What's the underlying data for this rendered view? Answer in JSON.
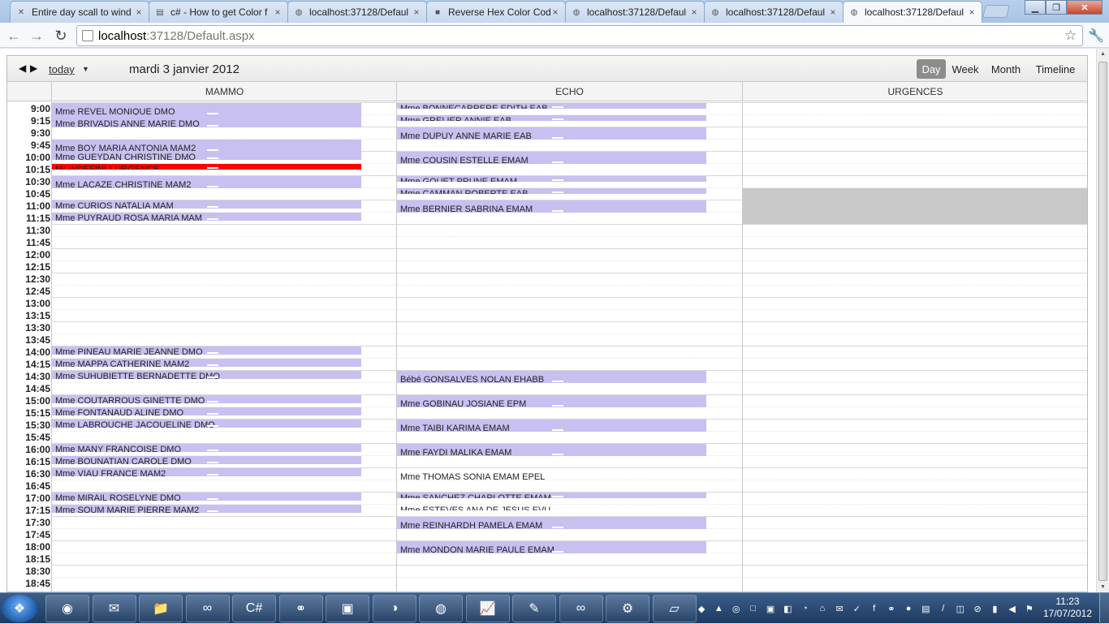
{
  "browser": {
    "tabs": [
      {
        "title": "Entire day scall to wind",
        "icon": "calendar-favicon"
      },
      {
        "title": "c# - How to get Color f",
        "icon": "stackoverflow-favicon"
      },
      {
        "title": "localhost:37128/Defaul",
        "icon": "globe-favicon"
      },
      {
        "title": "Reverse Hex Color Cod",
        "icon": "square-favicon"
      },
      {
        "title": "localhost:37128/Defaul",
        "icon": "globe-favicon"
      },
      {
        "title": "localhost:37128/Defaul",
        "icon": "globe-favicon"
      },
      {
        "title": "localhost:37128/Defaul",
        "icon": "globe-favicon"
      }
    ],
    "active_tab": 6,
    "url_host": "localhost",
    "url_rest": ":37128/Default.aspx"
  },
  "calendar": {
    "today_label": "today",
    "date_title": "mardi 3 janvier 2012",
    "views": [
      "Day",
      "Week",
      "Month",
      "Timeline"
    ],
    "active_view": "Day",
    "columns": [
      "MAMMO",
      "ECHO",
      "URGENCES"
    ],
    "times": [
      "9:00",
      "9:15",
      "9:30",
      "9:45",
      "10:00",
      "10:15",
      "10:30",
      "10:45",
      "11:00",
      "11:15",
      "11:30",
      "11:45",
      "12:00",
      "12:15",
      "12:30",
      "12:45",
      "13:00",
      "13:15",
      "13:30",
      "13:45",
      "14:00",
      "14:15",
      "14:30",
      "14:45",
      "15:00",
      "15:15",
      "15:30",
      "15:45",
      "16:00",
      "16:15",
      "16:30",
      "16:45",
      "17:00",
      "17:15",
      "17:30",
      "17:45",
      "18:00",
      "18:15",
      "18:30",
      "18:45"
    ],
    "events": [
      {
        "col": 0,
        "start": "9:00",
        "end": "9:15",
        "label": "Mme REVEL MONIQUE DMO"
      },
      {
        "col": 0,
        "start": "9:15",
        "end": "9:30",
        "label": "Mme BRIVADIS ANNE MARIE DMO"
      },
      {
        "col": 0,
        "start": "9:45",
        "end": "10:00",
        "label": "Mme BOY MARIA ANTONIA MAM2"
      },
      {
        "col": 0,
        "start": "10:00",
        "end": "10:10",
        "label": "Mme GUEYDAN CHRISTINE DMO"
      },
      {
        "col": 0,
        "start": "10:15",
        "end": "10:20",
        "label": "Mr INDEFINI * URGENCE",
        "color": "red"
      },
      {
        "col": 0,
        "start": "10:30",
        "end": "10:45",
        "label": "Mme LACAZE CHRISTINE MAM2"
      },
      {
        "col": 0,
        "start": "11:00",
        "end": "11:10",
        "label": "Mme CURIOS NATALIA MAM"
      },
      {
        "col": 0,
        "start": "11:15",
        "end": "11:25",
        "label": "Mme PUYRAUD ROSA MARIA MAM"
      },
      {
        "col": 0,
        "start": "14:00",
        "end": "14:10",
        "label": "Mme PINEAU MARIE JEANNE DMO"
      },
      {
        "col": 0,
        "start": "14:15",
        "end": "14:25",
        "label": "Mme MAPPA CATHERINE MAM2"
      },
      {
        "col": 0,
        "start": "14:30",
        "end": "14:40",
        "label": "Mme SUHUBIETTE BERNADETTE DMO"
      },
      {
        "col": 0,
        "start": "15:00",
        "end": "15:10",
        "label": "Mme COUTARROUS GINETTE DMO"
      },
      {
        "col": 0,
        "start": "15:15",
        "end": "15:25",
        "label": "Mme FONTANAUD ALINE DMO"
      },
      {
        "col": 0,
        "start": "15:30",
        "end": "15:40",
        "label": "Mme LABROUCHE JACQUELINE DMO"
      },
      {
        "col": 0,
        "start": "16:00",
        "end": "16:10",
        "label": "Mme MANY FRANCOISE DMO"
      },
      {
        "col": 0,
        "start": "16:15",
        "end": "16:25",
        "label": "Mme BOUNATIAN CAROLE DMO"
      },
      {
        "col": 0,
        "start": "16:30",
        "end": "16:40",
        "label": "Mme VIAU FRANCE MAM2"
      },
      {
        "col": 0,
        "start": "17:00",
        "end": "17:10",
        "label": "Mme MIRAIL ROSELYNE DMO"
      },
      {
        "col": 0,
        "start": "17:15",
        "end": "17:25",
        "label": "Mme SOUM MARIE PIERRE MAM2"
      },
      {
        "col": 1,
        "start": "9:00",
        "end": "9:05",
        "label": "Mme BONNECARRERE EDITH EAB"
      },
      {
        "col": 1,
        "start": "9:15",
        "end": "9:20",
        "label": "Mme GRELIER ANNIE EAB"
      },
      {
        "col": 1,
        "start": "9:30",
        "end": "9:45",
        "label": "Mme DUPUY ANNE MARIE EAB"
      },
      {
        "col": 1,
        "start": "10:00",
        "end": "10:15",
        "label": "Mme COUSIN ESTELLE EMAM"
      },
      {
        "col": 1,
        "start": "10:30",
        "end": "10:35",
        "label": "Mme GOUET PRUNE EMAM"
      },
      {
        "col": 1,
        "start": "10:45",
        "end": "10:50",
        "label": "Mme CAMMAN ROBERTE EAB"
      },
      {
        "col": 1,
        "start": "11:00",
        "end": "11:15",
        "label": "Mme BERNIER SABRINA EMAM"
      },
      {
        "col": 1,
        "start": "14:30",
        "end": "14:45",
        "label": "Bébé GONSALVES NOLAN EHABB"
      },
      {
        "col": 1,
        "start": "15:00",
        "end": "15:15",
        "label": "Mme GOBINAU JOSIANE EPM"
      },
      {
        "col": 1,
        "start": "15:30",
        "end": "15:45",
        "label": "Mme TAIBI KARIMA EMAM"
      },
      {
        "col": 1,
        "start": "16:00",
        "end": "16:15",
        "label": "Mme FAYDI MALIKA EMAM"
      },
      {
        "col": 1,
        "start": "16:30",
        "end": "16:45",
        "label": "Mme THOMAS SONIA EMAM EPEL",
        "color": "none"
      },
      {
        "col": 1,
        "start": "17:00",
        "end": "17:05",
        "label": "Mme SANCHEZ CHARLOTTE EMAM"
      },
      {
        "col": 1,
        "start": "17:15",
        "end": "17:20",
        "label": "Mme ESTEVES ANA DE JESUS EVU",
        "color": "none"
      },
      {
        "col": 1,
        "start": "17:30",
        "end": "17:45",
        "label": "Mme REINHARDH PAMELA EMAM"
      },
      {
        "col": 1,
        "start": "18:00",
        "end": "18:15",
        "label": "Mme MONDON MARIE PAULE EMAM"
      }
    ],
    "unavailable": [
      {
        "col": 2,
        "start": "10:45",
        "end": "11:30"
      }
    ],
    "event_color": "#c8c0f0",
    "urgent_color": "#ff0000"
  },
  "taskbar": {
    "apps": [
      "chrome-icon",
      "outlook-icon",
      "explorer-icon",
      "visual-studio-icon",
      "csharp-icon",
      "network-icon",
      "console-icon",
      "eclipse-icon",
      "firefox-icon",
      "chart-icon",
      "paint-icon",
      "infinity-icon",
      "tool-icon",
      "notepad-icon"
    ],
    "tray": [
      "tray-1",
      "tray-2",
      "tray-3",
      "tray-4",
      "tray-5",
      "tray-6",
      "tray-7",
      "tray-8",
      "tray-9",
      "tray-10",
      "tray-11",
      "tray-12",
      "tray-13",
      "tray-14",
      "tray-15",
      "tray-16",
      "tray-17",
      "tray-18",
      "tray-19",
      "tray-20"
    ],
    "time": "11:23",
    "date": "17/07/2012"
  }
}
